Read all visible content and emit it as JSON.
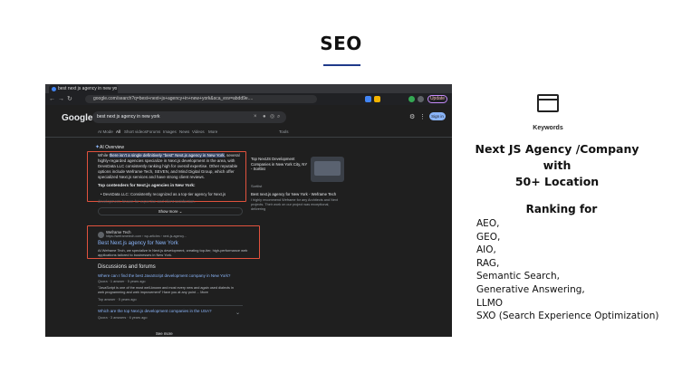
{
  "page": {
    "title": "SEO"
  },
  "browser": {
    "tab_title": "best next js agency in new yo",
    "tab_close": "×",
    "url": "google.com/search?q=best+next+js+agency+in+new+york&sca_esv=abdd9e....",
    "update_label": "Update",
    "accent_color": "#c58af9"
  },
  "google": {
    "logo": "Google",
    "query": "best next js agency in new york",
    "signin_label": "Sign in",
    "tabs": [
      "AI Mode",
      "All",
      "Short videos",
      "Forums",
      "Images",
      "News",
      "Videos",
      "More"
    ],
    "tools_label": "Tools",
    "ai_overview_label": "AI Overview",
    "ai_text_pre": "While ",
    "ai_text_highlight": "there isn't a single definitively \"best\" Next.js agency in New York",
    "ai_text_post": ", several highly-regarded agencies specialize in Next.js development in the area, with DevsData LLC consistently ranking high for overall expertise. Other reputable options include Weframe Tech, SEVEN, and Mind Digital Group, which offer specialized Next.js services and have strong client reviews.",
    "ai_subhead": "Top contenders for Next.js agencies in New York:",
    "ai_bullet": "DevsData LLC: Consistently recognized as a top-tier agency for Next.js",
    "ai_fade": "development, known for expertise and client satisfaction.",
    "card": {
      "title": "Top NextJS Development Companies in New York City, NY - Sortlist",
      "meta": "Sortlist",
      "title2": "Best next.js agency for New York - Weframe Tech",
      "desc": "I highly recommend Weframe for any Architects and Next projects. Their work on our project was exceptional, delivering"
    },
    "show_more": "Show more",
    "result": {
      "site": "Weframe Tech",
      "url": "https://weframetech.com › wp-articles › next-js-agency...",
      "title": "Best Next.js agency for New York",
      "desc": "At Weframe Tech, we specialize in Next.js development, creating top-tier, high-performance web applications tailored to businesses in New York."
    },
    "discussions": {
      "heading": "Discussions and forums",
      "q1": "Where can I find the best JavaScript development company in New York?",
      "q1_src": "Quora · 1 answer · 5 years ago",
      "q1_snip": "\"JavaScript is one of the most well-known and most every new and again used dialects in web programming and web improvement\" Have you at any point ... More",
      "q1_top": "Top answer · 5 years ago",
      "q2": "Which are the top Next.js development companies in the USA?",
      "q2_src": "Quora · 3 answers · 6 years ago",
      "see_more": "See more"
    }
  },
  "panel": {
    "keywords_label": "Keywords",
    "headline_line1": "Next JS Agency /Company with",
    "headline_line2": "50+ Location",
    "ranking_heading": "Ranking for",
    "ranking_items": [
      "AEO,",
      "GEO,",
      "AIO,",
      "RAG,",
      "Semantic Search,",
      "Generative Answering,",
      "LLMO",
      "SXO (Search Experience Optimization)"
    ]
  },
  "colors": {
    "highlight_box": "#e1523d",
    "title_rule": "#1f3a8a"
  }
}
